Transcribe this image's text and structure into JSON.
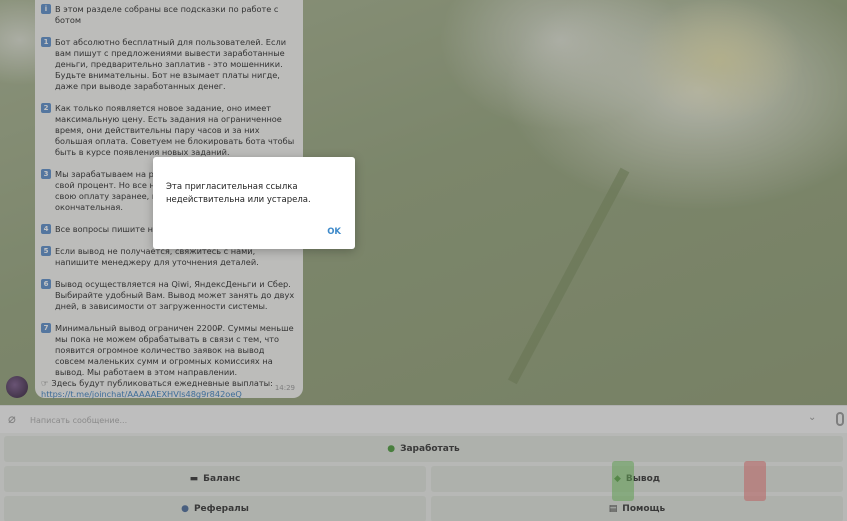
{
  "message": {
    "intro": "В этом разделе собраны все подсказки по работе с ботом",
    "paragraphs": [
      {
        "num": "1",
        "text": "Бот абсолютно бесплатный для пользователей. Если вам пишут с предложениями вывести заработанные деньги, предварительно заплатив - это мошенники. Будьте внимательны. Бот не взымает платы нигде, даже при выводе заработанных денег."
      },
      {
        "num": "2",
        "text": "Как только появляется новое задание, оно имеет максимальную цену. Есть задания на ограниченное время, они действительны пару часов и за них большая оплата. Советуем не блокировать бота чтобы быть в курсе появления новых заданий."
      },
      {
        "num": "3",
        "text": "Мы зарабатываем на рекламодателях и получаем свой процент. Но все наши пользователи получают свою оплату заранее, и указанная стоимость задания окончательная."
      },
      {
        "num": "4",
        "text": "Все вопросы пишите нам в поддержку."
      },
      {
        "num": "5",
        "text": "Если вывод не получается, свяжитесь с нами, напишите менеджеру для уточнения деталей."
      },
      {
        "num": "6",
        "text": "Вывод осуществляется на Qiwi, ЯндексДеньги и Сбер. Выбирайте удобный Вам. Вывод может занять до двух дней, в зависимости от загруженности системы."
      },
      {
        "num": "7",
        "text": "Минимальный вывод ограничен 2200₽. Суммы меньше мы пока не можем обрабатывать в связи с тем, что появится огромное количество заявок на вывод совсем маленьких сумм и огромных комиссиях на вывод. Мы работаем в этом направлении."
      }
    ],
    "payout_line": "Здесь будут публиковаться ежедневные выплаты:",
    "link": "https://t.me/joinchat/AAAAAEXHVIs48g9r842oeQ",
    "time": "14:29"
  },
  "input": {
    "placeholder": "Написать сообщение..."
  },
  "keyboard": {
    "earn": "Заработать",
    "balance": "Баланс",
    "withdraw": "Вывод",
    "referrals": "Рефералы",
    "help": "Помощь"
  },
  "dialog": {
    "text": "Эта пригласительная ссылка недействительна или устарела.",
    "ok": "OK"
  },
  "colors": {
    "accent": "#3d89c9",
    "link": "#3a7fbf"
  }
}
